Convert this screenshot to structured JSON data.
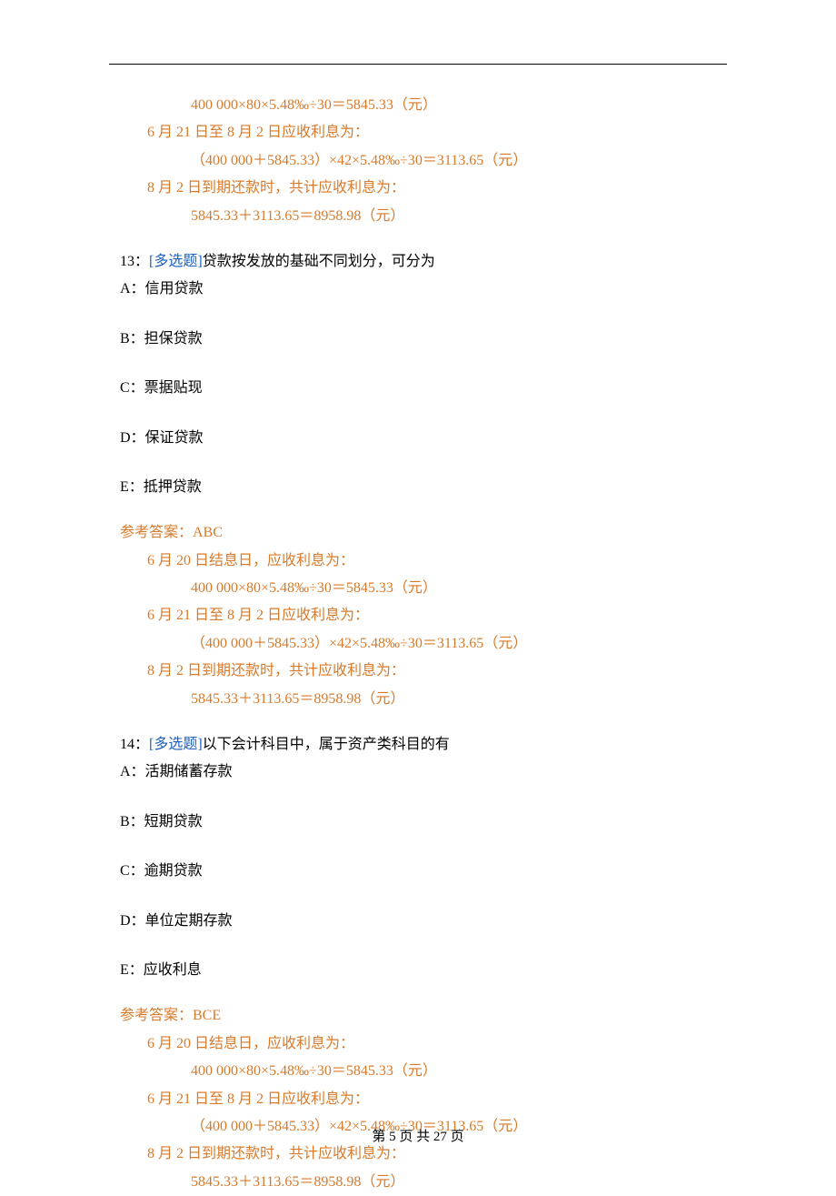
{
  "calc_block": {
    "line1a": "400 000×80×5.48‰÷30＝5845.33（元）",
    "line2": "6 月 21 日至 8 月 2 日应收利息为：",
    "line2a": "（400 000＋5845.33）×42×5.48‰÷30＝3113.65（元）",
    "line3": "8 月 2 日到期还款时，共计应收利息为：",
    "line3a": "5845.33＋3113.65＝8958.98（元）",
    "pre_line1": "6 月 20 日结息日，应收利息为："
  },
  "q13": {
    "num": "13：",
    "tag": "[多选题]",
    "stem": "贷款按发放的基础不同划分，可分为",
    "opts": {
      "A": "A：信用贷款",
      "B": "B：担保贷款",
      "C": "C：票据贴现",
      "D": "D：保证贷款",
      "E": "E：抵押贷款"
    },
    "ans": "参考答案：ABC"
  },
  "q14": {
    "num": "14：",
    "tag": "[多选题]",
    "stem": "以下会计科目中，属于资产类科目的有",
    "opts": {
      "A": "A：活期储蓄存款",
      "B": "B：短期贷款",
      "C": "C：逾期贷款",
      "D": "D：单位定期存款",
      "E": "E：应收利息"
    },
    "ans": "参考答案：BCE"
  },
  "footer": "第 5 页 共 27 页"
}
